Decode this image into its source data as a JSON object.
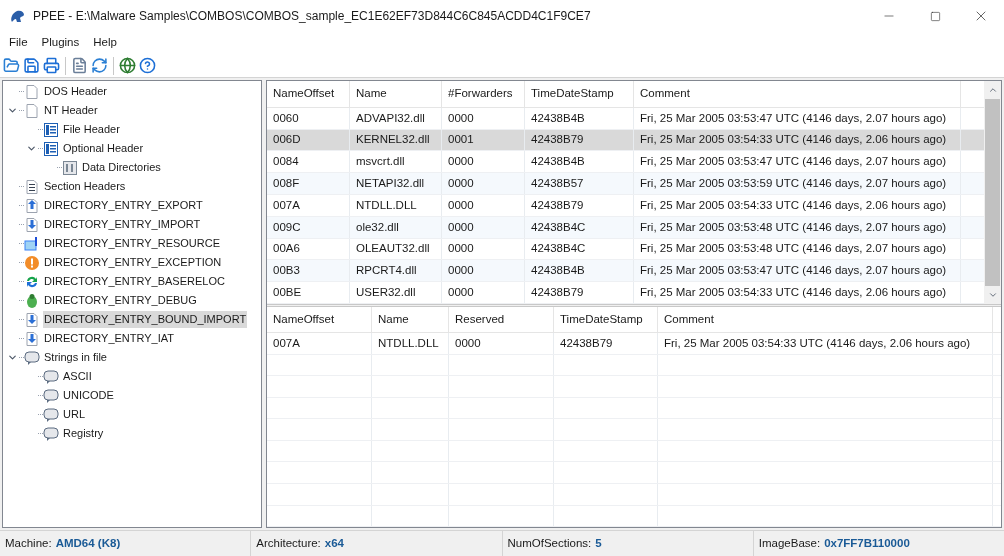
{
  "window": {
    "title": "PPEE - E:\\Malware Samples\\COMBOS\\COMBOS_sample_EC1E62EF73D844C6C845ACDD4C1F9CE7"
  },
  "menu": [
    "File",
    "Plugins",
    "Help"
  ],
  "tree": [
    {
      "label": "DOS Header",
      "selected": false
    },
    {
      "label": "NT Header",
      "selected": false,
      "expanded": true,
      "children": [
        {
          "label": "File Header",
          "selected": false
        },
        {
          "label": "Optional Header",
          "selected": false,
          "expanded": true,
          "children": [
            {
              "label": "Data Directories",
              "selected": false
            }
          ]
        }
      ]
    },
    {
      "label": "Section Headers",
      "selected": false
    },
    {
      "label": "DIRECTORY_ENTRY_EXPORT",
      "selected": false
    },
    {
      "label": "DIRECTORY_ENTRY_IMPORT",
      "selected": false
    },
    {
      "label": "DIRECTORY_ENTRY_RESOURCE",
      "selected": false
    },
    {
      "label": "DIRECTORY_ENTRY_EXCEPTION",
      "selected": false
    },
    {
      "label": "DIRECTORY_ENTRY_BASERELOC",
      "selected": false
    },
    {
      "label": "DIRECTORY_ENTRY_DEBUG",
      "selected": false
    },
    {
      "label": "DIRECTORY_ENTRY_BOUND_IMPORT",
      "selected": true
    },
    {
      "label": "DIRECTORY_ENTRY_IAT",
      "selected": false
    },
    {
      "label": "Strings in file",
      "selected": false,
      "expanded": true,
      "children": [
        {
          "label": "ASCII",
          "selected": false
        },
        {
          "label": "UNICODE",
          "selected": false
        },
        {
          "label": "URL",
          "selected": false
        },
        {
          "label": "Registry",
          "selected": false
        }
      ]
    }
  ],
  "top_table": {
    "columns": [
      "NameOffset",
      "Name",
      "#Forwarders",
      "TimeDateStamp",
      "Comment"
    ],
    "rows": [
      {
        "cells": [
          "0060",
          "ADVAPI32.dll",
          "0000",
          "42438B4B",
          "Fri, 25 Mar 2005 03:53:47 UTC (4146 days, 2.07 hours ago)"
        ],
        "selected": false
      },
      {
        "cells": [
          "006D",
          "KERNEL32.dll",
          "0001",
          "42438B79",
          "Fri, 25 Mar 2005 03:54:33 UTC (4146 days, 2.06 hours ago)"
        ],
        "selected": true
      },
      {
        "cells": [
          "0084",
          "msvcrt.dll",
          "0000",
          "42438B4B",
          "Fri, 25 Mar 2005 03:53:47 UTC (4146 days, 2.07 hours ago)"
        ],
        "selected": false
      },
      {
        "cells": [
          "008F",
          "NETAPI32.dll",
          "0000",
          "42438B57",
          "Fri, 25 Mar 2005 03:53:59 UTC (4146 days, 2.07 hours ago)"
        ],
        "selected": false
      },
      {
        "cells": [
          "007A",
          "NTDLL.DLL",
          "0000",
          "42438B79",
          "Fri, 25 Mar 2005 03:54:33 UTC (4146 days, 2.06 hours ago)"
        ],
        "selected": false
      },
      {
        "cells": [
          "009C",
          "ole32.dll",
          "0000",
          "42438B4C",
          "Fri, 25 Mar 2005 03:53:48 UTC (4146 days, 2.07 hours ago)"
        ],
        "selected": false
      },
      {
        "cells": [
          "00A6",
          "OLEAUT32.dll",
          "0000",
          "42438B4C",
          "Fri, 25 Mar 2005 03:53:48 UTC (4146 days, 2.07 hours ago)"
        ],
        "selected": false
      },
      {
        "cells": [
          "00B3",
          "RPCRT4.dll",
          "0000",
          "42438B4B",
          "Fri, 25 Mar 2005 03:53:47 UTC (4146 days, 2.07 hours ago)"
        ],
        "selected": false
      },
      {
        "cells": [
          "00BE",
          "USER32.dll",
          "0000",
          "42438B79",
          "Fri, 25 Mar 2005 03:54:33 UTC (4146 days, 2.06 hours ago)"
        ],
        "selected": false
      }
    ]
  },
  "bottom_table": {
    "columns": [
      "NameOffset",
      "Name",
      "Reserved",
      "TimeDateStamp",
      "Comment"
    ],
    "rows": [
      {
        "cells": [
          "007A",
          "NTDLL.DLL",
          "0000",
          "42438B79",
          "Fri, 25 Mar 2005 03:54:33 UTC (4146 days, 2.06 hours ago)"
        ],
        "selected": false
      }
    ]
  },
  "status_bar": [
    {
      "label": "Machine:",
      "value": "AMD64 (K8)"
    },
    {
      "label": "Architecture:",
      "value": "x64"
    },
    {
      "label": "NumOfSections:",
      "value": "5"
    },
    {
      "label": "ImageBase:",
      "value": "0x7FF7B110000"
    }
  ]
}
